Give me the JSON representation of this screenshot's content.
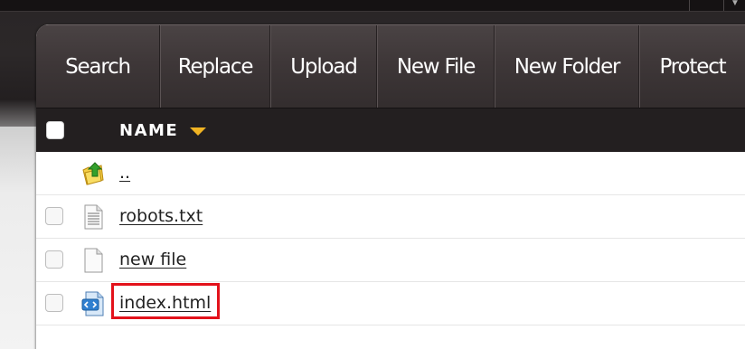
{
  "toolbar": {
    "buttons": [
      {
        "label": "Search"
      },
      {
        "label": "Replace"
      },
      {
        "label": "Upload"
      },
      {
        "label": "New File"
      },
      {
        "label": "New Folder"
      },
      {
        "label": "Protect"
      }
    ]
  },
  "table": {
    "header": {
      "name_label": "NAME",
      "sort": "descending"
    },
    "rows": [
      {
        "name": "..",
        "type": "parent-folder",
        "icon": "folder-up-icon",
        "has_checkbox": false
      },
      {
        "name": "robots.txt",
        "type": "text-file",
        "icon": "text-file-icon",
        "has_checkbox": true
      },
      {
        "name": "new file",
        "type": "blank-file",
        "icon": "blank-file-icon",
        "has_checkbox": true
      },
      {
        "name": "index.html",
        "type": "html-file",
        "icon": "html-file-icon",
        "has_checkbox": true,
        "highlighted": true
      }
    ]
  },
  "colors": {
    "toolbar_bg": "#3e3738",
    "header_bg": "#231f20",
    "sort_arrow": "#f0b323",
    "highlight_border": "#e3121b"
  }
}
